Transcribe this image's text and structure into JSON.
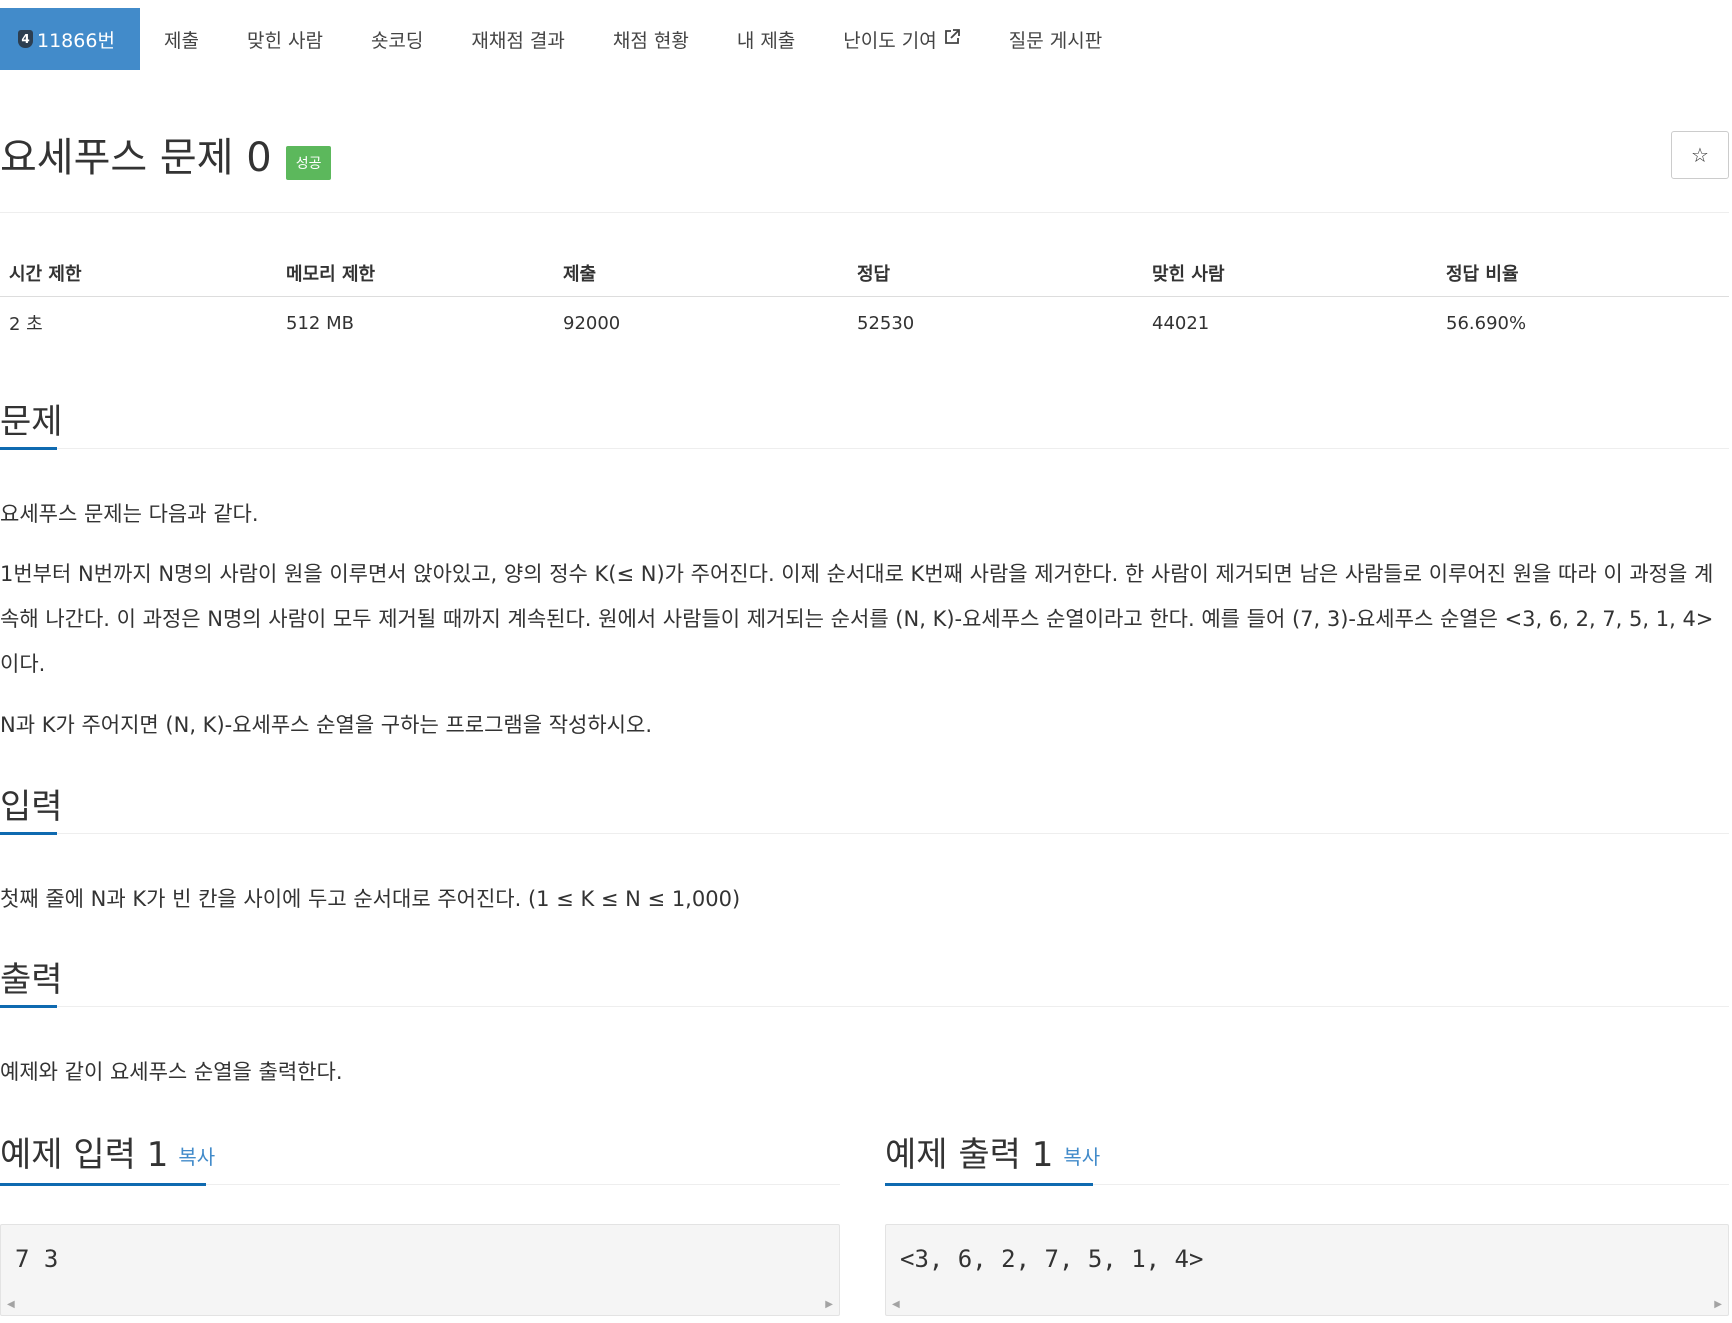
{
  "tabs": [
    {
      "label": "11866번",
      "tier": "4"
    },
    {
      "label": "제출"
    },
    {
      "label": "맞힌 사람"
    },
    {
      "label": "숏코딩"
    },
    {
      "label": "재채점 결과"
    },
    {
      "label": "채점 현황"
    },
    {
      "label": "내 제출"
    },
    {
      "label": "난이도 기여"
    },
    {
      "label": "질문 게시판"
    }
  ],
  "problem": {
    "title": "요세푸스 문제 0",
    "status_badge": "성공",
    "star": "☆"
  },
  "stats": {
    "headers": [
      "시간 제한",
      "메모리 제한",
      "제출",
      "정답",
      "맞힌 사람",
      "정답 비율"
    ],
    "values": [
      "2 초",
      "512 MB",
      "92000",
      "52530",
      "44021",
      "56.690%"
    ]
  },
  "sections": {
    "problem": {
      "heading": "문제",
      "paragraphs": [
        "요세푸스 문제는 다음과 같다.",
        "1번부터 N번까지 N명의 사람이 원을 이루면서 앉아있고, 양의 정수 K(≤ N)가 주어진다. 이제 순서대로 K번째 사람을 제거한다. 한 사람이 제거되면 남은 사람들로 이루어진 원을 따라 이 과정을 계속해 나간다. 이 과정은 N명의 사람이 모두 제거될 때까지 계속된다. 원에서 사람들이 제거되는 순서를 (N, K)-요세푸스 순열이라고 한다. 예를 들어 (7, 3)-요세푸스 순열은 <3, 6, 2, 7, 5, 1, 4>이다.",
        "N과 K가 주어지면 (N, K)-요세푸스 순열을 구하는 프로그램을 작성하시오."
      ]
    },
    "input": {
      "heading": "입력",
      "text": "첫째 줄에 N과 K가 빈 칸을 사이에 두고 순서대로 주어진다. (1 ≤ K ≤ N ≤ 1,000)"
    },
    "output": {
      "heading": "출력",
      "text": "예제와 같이 요세푸스 순열을 출력한다."
    }
  },
  "samples": {
    "input": {
      "heading": "예제 입력 1",
      "copy_label": "복사",
      "content": "7 3"
    },
    "output": {
      "heading": "예제 출력 1",
      "copy_label": "복사",
      "content": "<3, 6, 2, 7, 5, 1, 4>"
    }
  },
  "colors": {
    "accent": "#428bca",
    "section_underline": "#0f6ab0",
    "success": "#5cb85c"
  }
}
